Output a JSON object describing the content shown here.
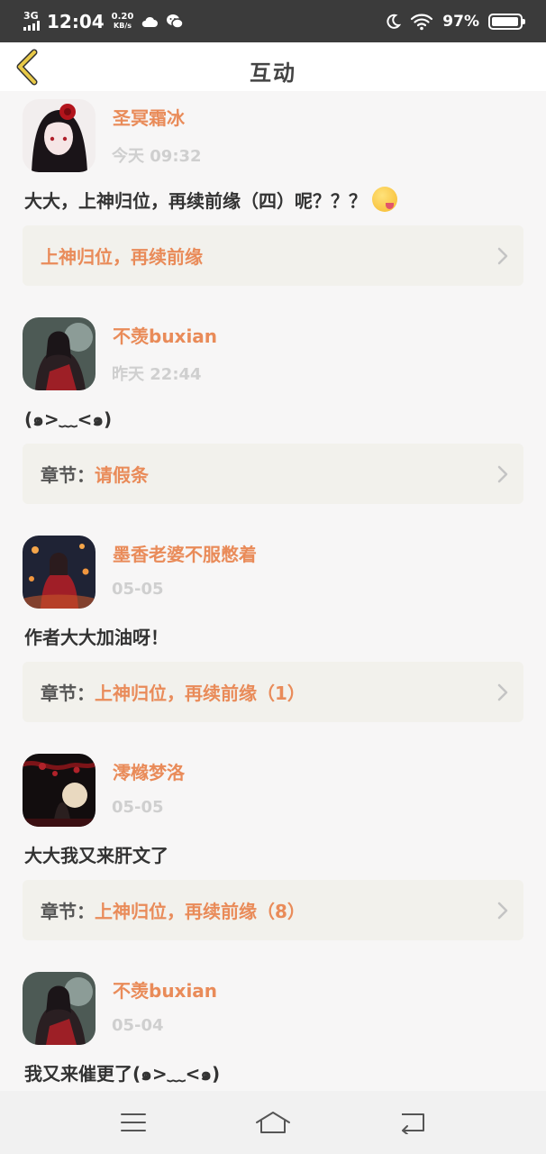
{
  "status_bar": {
    "network": "3G",
    "time": "12:04",
    "speed_value": "0.20",
    "speed_unit": "KB/s",
    "battery_percent": "97%",
    "battery_level": 0.97,
    "icons": [
      "signal-icon",
      "cloud-icon",
      "wechat-icon",
      "moon-icon",
      "wifi-icon",
      "battery-icon"
    ]
  },
  "header": {
    "title": "互动",
    "back_icon": "chevron-left-icon"
  },
  "comments": [
    {
      "username": "圣冥霜冰",
      "time": "今天 09:32",
      "content": "大大，上神归位，再续前缘（四）呢？？？",
      "has_emoji": true,
      "chapter_prefix": "",
      "chapter_title": "上神归位，再续前缘"
    },
    {
      "username": "不羡buxian",
      "time": "昨天 22:44",
      "content": "(๑>﹏<๑)",
      "chapter_prefix": "章节：",
      "chapter_title": "请假条"
    },
    {
      "username": "墨香老婆不服憋着",
      "time": "05-05",
      "content": "作者大大加油呀！",
      "chapter_prefix": "章节：",
      "chapter_title": "上神归位，再续前缘（1）"
    },
    {
      "username": "澪橼梦洛",
      "time": "05-05",
      "content": "大大我又来肝文了",
      "chapter_prefix": "章节：",
      "chapter_title": "上神归位，再续前缘（8）"
    },
    {
      "username": "不羡buxian",
      "time": "05-04",
      "content": "我又来催更了(๑>﹏<๑)"
    }
  ],
  "bottom_nav": {
    "items": [
      "menu-icon",
      "home-icon",
      "back-icon"
    ]
  },
  "colors": {
    "accent": "#e98b59",
    "back_arrow": "#e8c948",
    "card_bg": "#f2f1ec",
    "page_bg": "#f7f6f6"
  }
}
